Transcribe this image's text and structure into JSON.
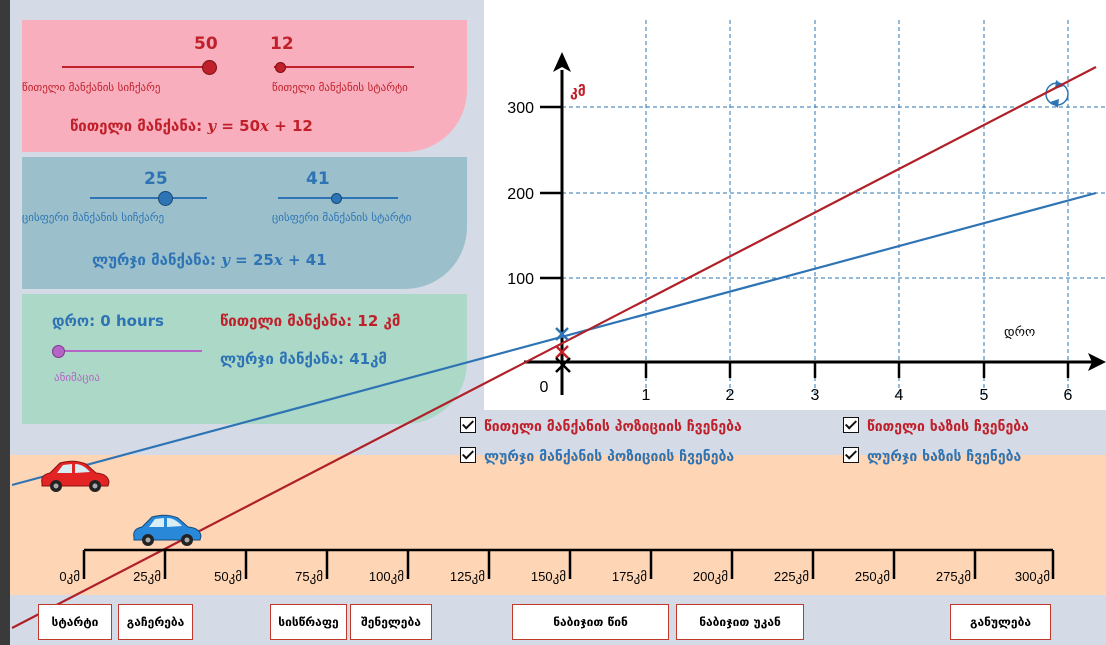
{
  "colors": {
    "red": "#c0202a",
    "blue": "#2e74b5",
    "purple": "#b565c5",
    "red_panel": "#f8aebd",
    "blue_panel": "#9bc0cb",
    "green_panel": "#acd8c7",
    "road": "#fed6b6"
  },
  "red_panel": {
    "speed_value": "50",
    "speed_label": "წითელი მანქანის სიჩქარე",
    "start_value": "12",
    "start_label": "წითელი მანქანის სტარტი",
    "equation_prefix": "წითელი მანქანა:",
    "equation_y": "y",
    "equation_mid": " = 50",
    "equation_x": "x",
    "equation_suffix": " + 12",
    "speed_slider_level": 1.0,
    "start_slider_level": 0.1
  },
  "blue_panel": {
    "speed_value": "25",
    "speed_label": "ცისფერი მანქანის სიჩქარე",
    "start_value": "41",
    "start_label": "ცისფერი მანქანის სტარტი",
    "equation_prefix": "ლურჯი მანქანა:",
    "equation_y": "y",
    "equation_mid": " = 25",
    "equation_x": "x",
    "equation_suffix": " + 41",
    "speed_slider_level": 0.5,
    "start_slider_level": 0.5
  },
  "time_panel": {
    "time_text": "დრო: 0 hours",
    "animation_label": "ანიმაცია",
    "red_position_text": "წითელი მანქანა: 12 კმ",
    "blue_position_text": "ლურჯი მანქანა: 41კმ",
    "animation_slider_level": 0.0
  },
  "graph": {
    "y_axis_label": "კმ",
    "x_axis_label": "დრო",
    "origin_label": "0",
    "x_ticks": [
      "1",
      "2",
      "3",
      "4",
      "5",
      "6"
    ],
    "y_ticks": [
      "100",
      "200",
      "300"
    ]
  },
  "checkboxes": {
    "show_red_position": "წითელი მანქანის პოზიციის ჩვენება",
    "show_red_line": "წითელი ხაზის ჩვენება",
    "show_blue_position": "ლურჯი მანქანის პოზიციის ჩვენება",
    "show_blue_line": "ლურჯი ხაზის ჩვენება"
  },
  "road_marks": [
    "0კმ",
    "25კმ",
    "50კმ",
    "75კმ",
    "100კმ",
    "125კმ",
    "150კმ",
    "175კმ",
    "200კმ",
    "225კმ",
    "250კმ",
    "275კმ",
    "300კმ"
  ],
  "buttons": {
    "start": "სტარტი",
    "stop": "გაჩერება",
    "faster": "სისწრაფე",
    "slower": "შენელება",
    "step_forward": "ნაბიჯით წინ",
    "step_back": "ნაბიჯით უკან",
    "reset": "განულება"
  },
  "icons": {
    "reset_view": "refresh-icon",
    "check": "checkmark-icon",
    "red_car": "red-car-icon",
    "blue_car": "blue-car-icon"
  }
}
